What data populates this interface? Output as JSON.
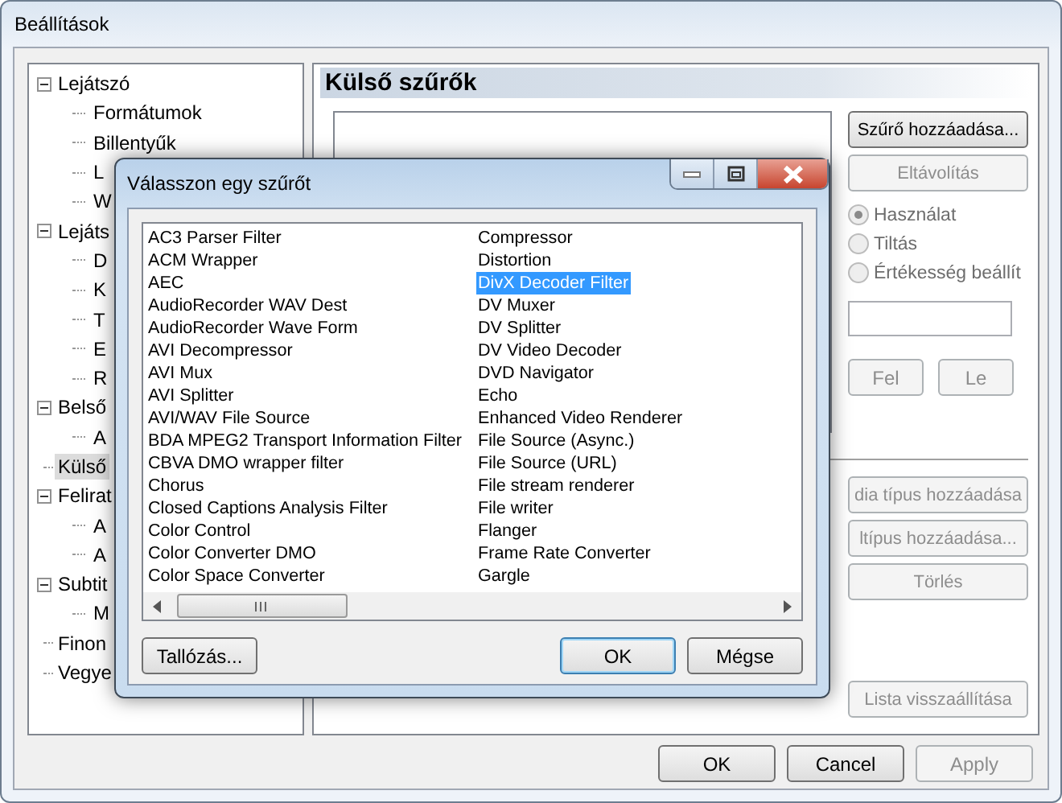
{
  "window": {
    "title": "Beállítások"
  },
  "tree": [
    {
      "label": "Lejátszó",
      "expanded": true,
      "selected": false,
      "children": [
        {
          "label": "Formátumok",
          "selected": false
        },
        {
          "label": "Billentyűk",
          "selected": false
        },
        {
          "label": "L",
          "selected": false
        },
        {
          "label": "W",
          "selected": false
        }
      ]
    },
    {
      "label": "Lejáts",
      "expanded": true,
      "selected": false,
      "children": [
        {
          "label": "D",
          "selected": false
        },
        {
          "label": "K",
          "selected": false
        },
        {
          "label": "T",
          "selected": false
        },
        {
          "label": "E",
          "selected": false
        },
        {
          "label": "R",
          "selected": false
        }
      ]
    },
    {
      "label": "Belső",
      "expanded": true,
      "selected": false,
      "children": [
        {
          "label": "A",
          "selected": false
        }
      ]
    },
    {
      "label": "Külső",
      "selected": true
    },
    {
      "label": "Felirat",
      "expanded": true,
      "selected": false,
      "children": [
        {
          "label": "A",
          "selected": false
        },
        {
          "label": "A",
          "selected": false
        }
      ]
    },
    {
      "label": "Subtit",
      "expanded": true,
      "selected": false,
      "children": [
        {
          "label": "M",
          "selected": false
        }
      ]
    },
    {
      "label": "Finon",
      "selected": false
    },
    {
      "label": "Vegye",
      "selected": false
    }
  ],
  "panel": {
    "title": "Külső szűrők",
    "side_buttons": [
      {
        "label": "Szűrő hozzáadása...",
        "disabled": false
      },
      {
        "label": "Eltávolítás",
        "disabled": true
      }
    ],
    "radios": [
      {
        "label": "Használat",
        "selected": true,
        "disabled": true
      },
      {
        "label": "Tiltás",
        "selected": false,
        "disabled": true
      },
      {
        "label": "Értékesség beállít",
        "selected": false,
        "disabled": true
      }
    ],
    "move_buttons": [
      {
        "label": "Fel",
        "disabled": true
      },
      {
        "label": "Le",
        "disabled": true
      }
    ],
    "type_buttons": [
      {
        "label": "dia típus hozzáadása",
        "disabled": true
      },
      {
        "label": "ltípus hozzáadása...",
        "disabled": true
      },
      {
        "label": "Törlés",
        "disabled": true
      }
    ],
    "reset_button": {
      "label": "Lista visszaállítása",
      "disabled": true
    }
  },
  "footer_buttons": [
    {
      "label": "OK",
      "disabled": false
    },
    {
      "label": "Cancel",
      "disabled": false
    },
    {
      "label": "Apply",
      "disabled": true
    }
  ],
  "dialog": {
    "title": "Válasszon egy szűrőt",
    "items": [
      {
        "label": "AC3 Parser Filter",
        "selected": false
      },
      {
        "label": "ACM Wrapper",
        "selected": false
      },
      {
        "label": "AEC",
        "selected": false
      },
      {
        "label": "AudioRecorder WAV Dest",
        "selected": false
      },
      {
        "label": "AudioRecorder Wave Form",
        "selected": false
      },
      {
        "label": "AVI Decompressor",
        "selected": false
      },
      {
        "label": "AVI Mux",
        "selected": false
      },
      {
        "label": "AVI Splitter",
        "selected": false
      },
      {
        "label": "AVI/WAV File Source",
        "selected": false
      },
      {
        "label": "BDA MPEG2 Transport Information Filter",
        "selected": false
      },
      {
        "label": "CBVA DMO wrapper filter",
        "selected": false
      },
      {
        "label": "Chorus",
        "selected": false
      },
      {
        "label": "Closed Captions Analysis Filter",
        "selected": false
      },
      {
        "label": "Color Control",
        "selected": false
      },
      {
        "label": "Color Converter DMO",
        "selected": false
      },
      {
        "label": "Color Space Converter",
        "selected": false
      },
      {
        "label": "Compressor",
        "selected": false
      },
      {
        "label": "Distortion",
        "selected": false
      },
      {
        "label": "DivX Decoder Filter",
        "selected": true
      },
      {
        "label": "DV Muxer",
        "selected": false
      },
      {
        "label": "DV Splitter",
        "selected": false
      },
      {
        "label": "DV Video Decoder",
        "selected": false
      },
      {
        "label": "DVD Navigator",
        "selected": false
      },
      {
        "label": "Echo",
        "selected": false
      },
      {
        "label": "Enhanced Video Renderer",
        "selected": false
      },
      {
        "label": "File Source (Async.)",
        "selected": false
      },
      {
        "label": "File Source (URL)",
        "selected": false
      },
      {
        "label": "File stream renderer",
        "selected": false
      },
      {
        "label": "File writer",
        "selected": false
      },
      {
        "label": "Flanger",
        "selected": false
      },
      {
        "label": "Frame Rate Converter",
        "selected": false
      },
      {
        "label": "Gargle",
        "selected": false
      }
    ],
    "buttons": [
      {
        "label": "Tallózás...",
        "default": false
      },
      {
        "label": "OK",
        "default": true
      },
      {
        "label": "Mégse",
        "default": false
      }
    ]
  }
}
